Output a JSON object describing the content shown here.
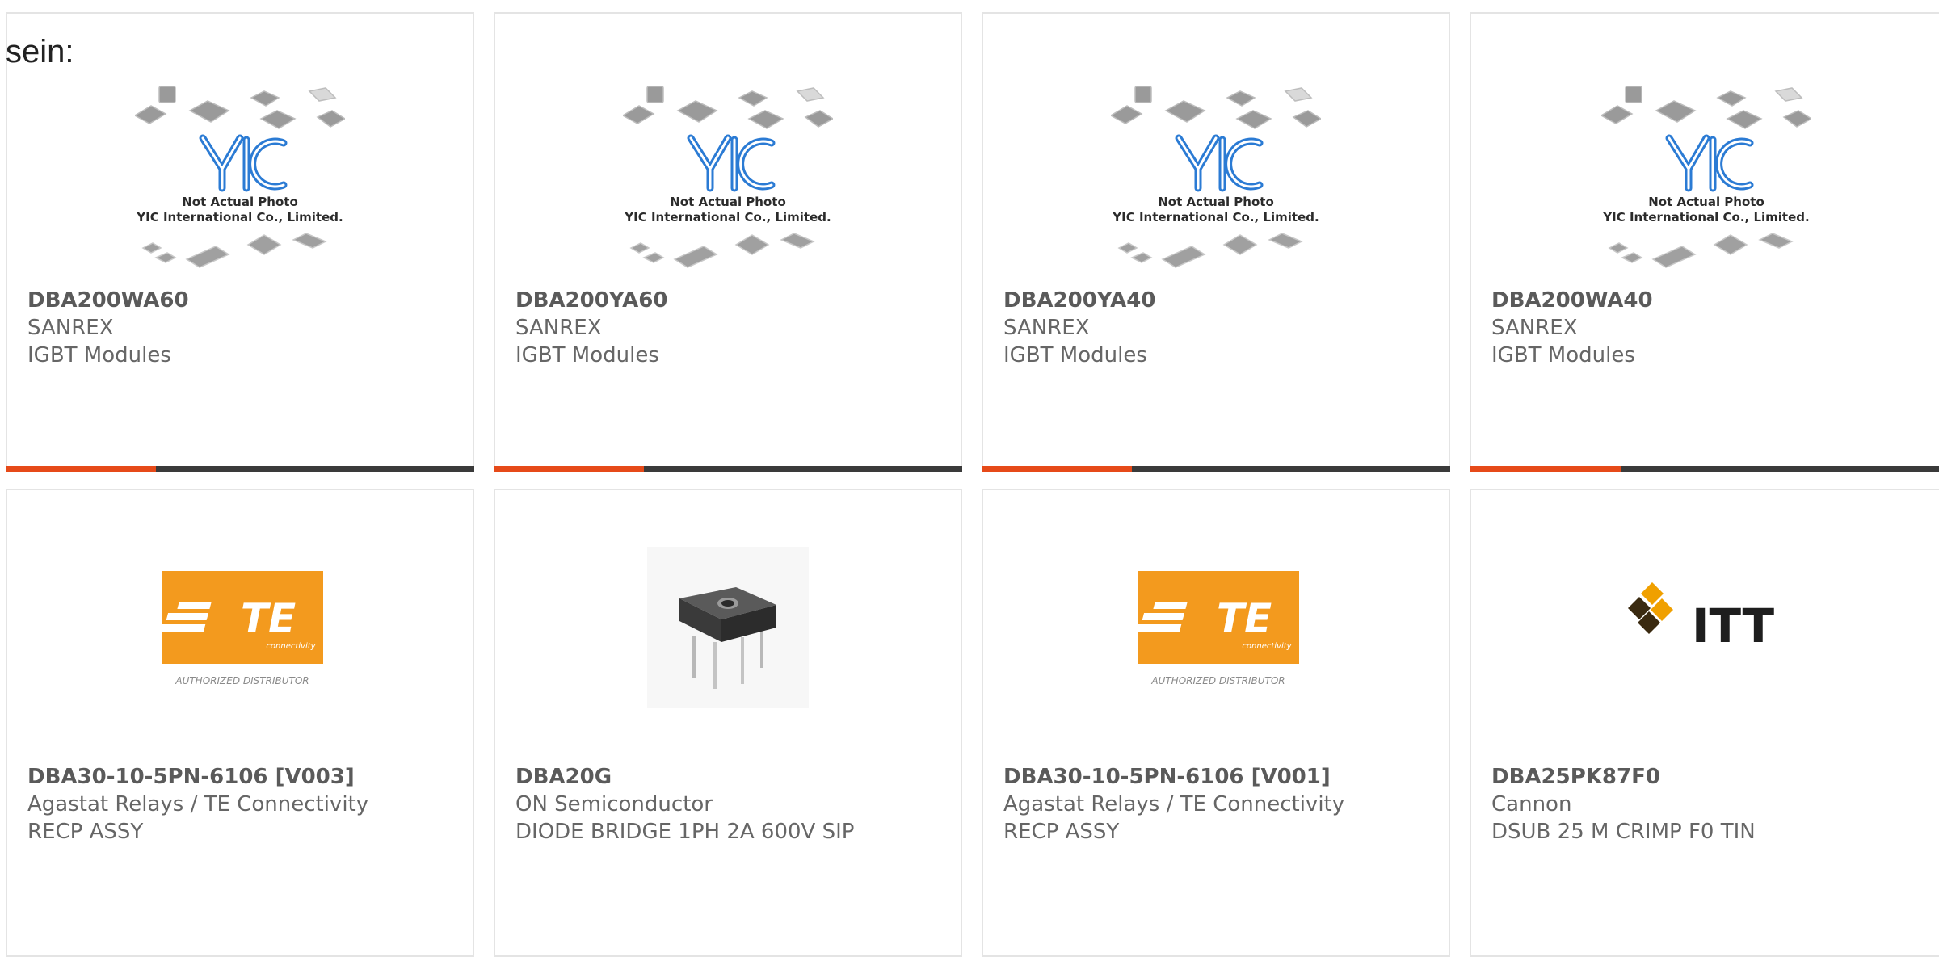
{
  "intro_text": "sein:",
  "placeholder_image": {
    "line1": "Not Actual Photo",
    "line2": "YIC International Co., Limited."
  },
  "te_logo": {
    "brand": "TE",
    "subtitle": "connectivity",
    "caption": "AUTHORIZED DISTRIBUTOR"
  },
  "itt_logo": {
    "brand": "ITT"
  },
  "colors": {
    "accent": "#e64a19",
    "bar": "#3a3a3a",
    "border": "#e4e4e4",
    "te_orange": "#f39a1e"
  },
  "products": [
    {
      "part": "DBA200WA60",
      "manufacturer": "SANREX",
      "description": "IGBT Modules",
      "image": "yic-placeholder"
    },
    {
      "part": "DBA200YA60",
      "manufacturer": "SANREX",
      "description": "IGBT Modules",
      "image": "yic-placeholder"
    },
    {
      "part": "DBA200YA40",
      "manufacturer": "SANREX",
      "description": "IGBT Modules",
      "image": "yic-placeholder"
    },
    {
      "part": "DBA200WA40",
      "manufacturer": "SANREX",
      "description": "IGBT Modules",
      "image": "yic-placeholder"
    },
    {
      "part": "DBA30-10-5PN-6106 [V003]",
      "manufacturer": "Agastat Relays / TE Connectivity",
      "description": "RECP ASSY",
      "image": "te-logo"
    },
    {
      "part": "DBA20G",
      "manufacturer": "ON Semiconductor",
      "description": "DIODE BRIDGE 1PH 2A 600V SIP",
      "image": "diode-bridge"
    },
    {
      "part": "DBA30-10-5PN-6106 [V001]",
      "manufacturer": "Agastat Relays / TE Connectivity",
      "description": "RECP ASSY",
      "image": "te-logo"
    },
    {
      "part": "DBA25PK87F0",
      "manufacturer": "Cannon",
      "description": "DSUB 25 M CRIMP F0 TIN",
      "image": "itt-logo"
    }
  ]
}
